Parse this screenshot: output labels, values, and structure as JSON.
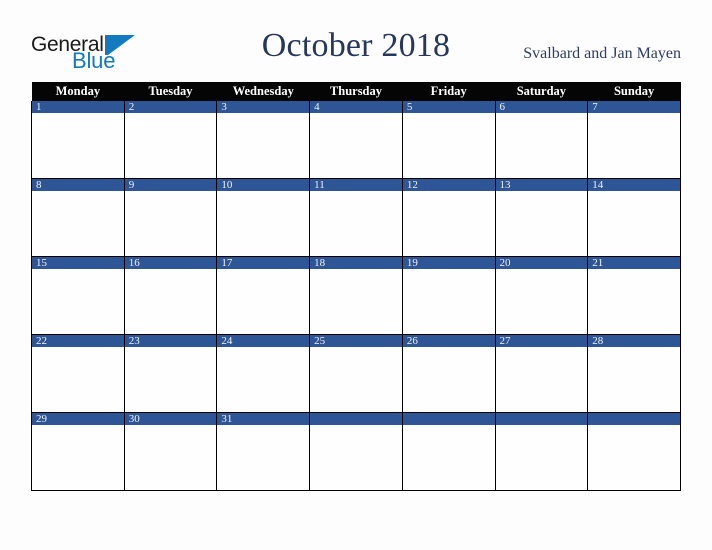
{
  "logo": {
    "text_primary": "General",
    "text_secondary": "Blue",
    "mark": "triangle-logo-mark",
    "color_primary": "#1b1b1b",
    "color_secondary": "#1479bd"
  },
  "header": {
    "title": "October 2018",
    "region": "Svalbard and Jan Mayen",
    "title_color": "#26375e",
    "region_color": "#2b3d66"
  },
  "calendar": {
    "month": "October",
    "year": "2018",
    "weekday_headers": [
      "Monday",
      "Tuesday",
      "Wednesday",
      "Thursday",
      "Friday",
      "Saturday",
      "Sunday"
    ],
    "header_bg": "#050505",
    "header_fg": "#ffffff",
    "daybar_bg": "#2e5596",
    "daybar_fg": "#f2f4f8",
    "cell_bg": "#ffffff",
    "grid_color": "#000000",
    "weeks": [
      {
        "days": [
          {
            "number": "1"
          },
          {
            "number": "2"
          },
          {
            "number": "3"
          },
          {
            "number": "4"
          },
          {
            "number": "5"
          },
          {
            "number": "6"
          },
          {
            "number": "7"
          }
        ]
      },
      {
        "days": [
          {
            "number": "8"
          },
          {
            "number": "9"
          },
          {
            "number": "10"
          },
          {
            "number": "11"
          },
          {
            "number": "12"
          },
          {
            "number": "13"
          },
          {
            "number": "14"
          }
        ]
      },
      {
        "days": [
          {
            "number": "15"
          },
          {
            "number": "16"
          },
          {
            "number": "17"
          },
          {
            "number": "18"
          },
          {
            "number": "19"
          },
          {
            "number": "20"
          },
          {
            "number": "21"
          }
        ]
      },
      {
        "days": [
          {
            "number": "22"
          },
          {
            "number": "23"
          },
          {
            "number": "24"
          },
          {
            "number": "25"
          },
          {
            "number": "26"
          },
          {
            "number": "27"
          },
          {
            "number": "28"
          }
        ]
      },
      {
        "days": [
          {
            "number": "29"
          },
          {
            "number": "30"
          },
          {
            "number": "31"
          },
          {
            "number": ""
          },
          {
            "number": ""
          },
          {
            "number": ""
          },
          {
            "number": ""
          }
        ]
      }
    ]
  }
}
